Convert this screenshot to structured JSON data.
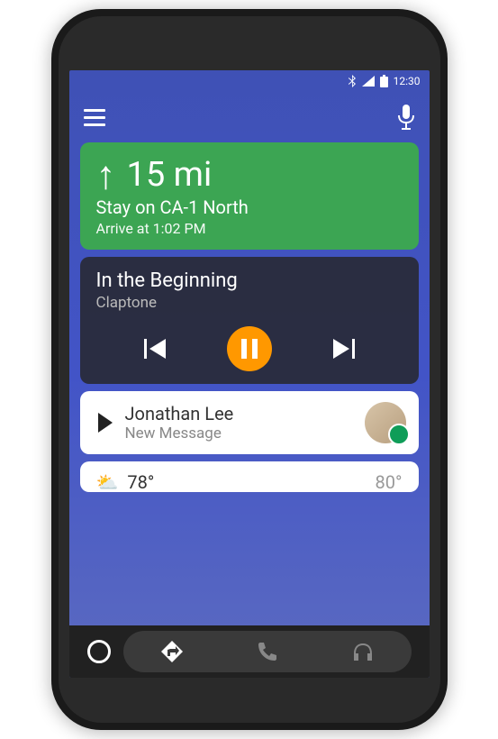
{
  "statusbar": {
    "time": "12:30"
  },
  "navigation": {
    "distance": "15 mi",
    "instruction": "Stay on CA-1 North",
    "eta": "Arrive at 1:02 PM"
  },
  "music": {
    "title": "In the Beginning",
    "artist": "Claptone"
  },
  "message": {
    "sender": "Jonathan Lee",
    "subtitle": "New Message"
  },
  "weather": {
    "current_temp": "78°",
    "high_temp": "80°"
  }
}
